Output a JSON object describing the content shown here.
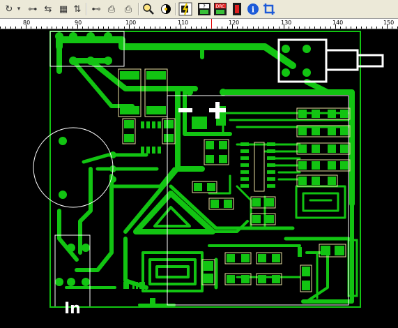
{
  "toolbar": {
    "buttons": [
      {
        "name": "refresh-icon",
        "glyph": "↻"
      },
      {
        "name": "dropdown-arrow-icon",
        "glyph": "▾"
      },
      {
        "name": "route-icon",
        "glyph": "⊶"
      },
      {
        "name": "connect-icon",
        "glyph": "⇆"
      },
      {
        "name": "grid-icon",
        "glyph": "▦"
      },
      {
        "name": "align-icon",
        "glyph": "⇅"
      },
      {
        "name": "measure-icon",
        "glyph": "⊷"
      },
      {
        "name": "print-icon",
        "glyph": "⎙"
      },
      {
        "name": "zoom-icon",
        "glyph": "🔍"
      },
      {
        "name": "contrast-icon",
        "glyph": "◐"
      },
      {
        "name": "component-icon",
        "glyph": "⚡"
      },
      {
        "name": "check-icon",
        "glyph": "?"
      },
      {
        "name": "drc-icon",
        "glyph": "DRC"
      },
      {
        "name": "stop-icon",
        "glyph": "■"
      },
      {
        "name": "info-icon",
        "glyph": "i"
      },
      {
        "name": "crop-icon",
        "glyph": "⌗"
      }
    ]
  },
  "ruler": {
    "labels": [
      "80",
      "90",
      "100",
      "110",
      "120",
      "130",
      "140",
      "150"
    ]
  },
  "board": {
    "silk_text": "In",
    "polarity_minus": "−",
    "polarity_plus": "+",
    "colors": {
      "background": "#000000",
      "copper": "#12c412",
      "silk": "#ffffff",
      "pad_outline": "#e8e0a0"
    }
  }
}
